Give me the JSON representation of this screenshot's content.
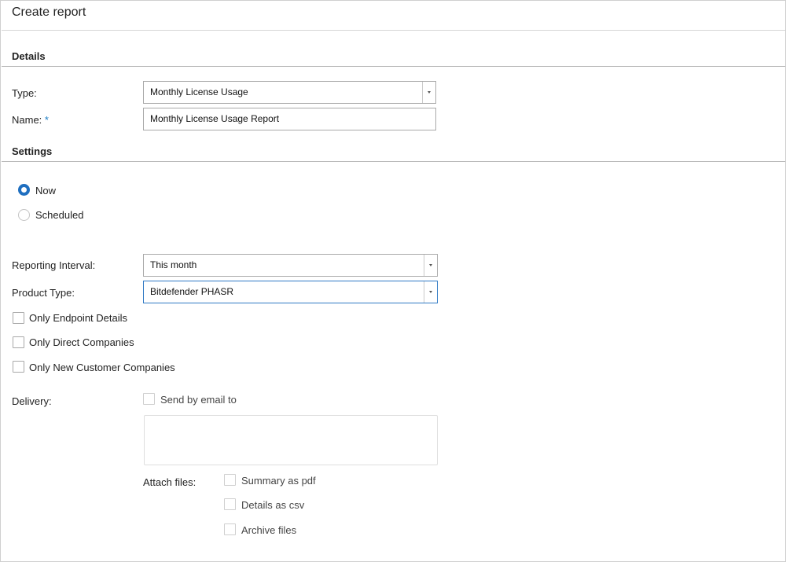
{
  "window": {
    "title": "Create report"
  },
  "details": {
    "heading": "Details",
    "type_label": "Type:",
    "type_value": "Monthly License Usage",
    "name_label": "Name:",
    "name_required_marker": "*",
    "name_value": "Monthly License Usage Report"
  },
  "settings": {
    "heading": "Settings",
    "radio_now": "Now",
    "radio_scheduled": "Scheduled",
    "selected": "Now",
    "interval_label": "Reporting Interval:",
    "interval_value": "This month",
    "product_label": "Product Type:",
    "product_value": "Bitdefender PHASR",
    "check_endpoint": "Only Endpoint Details",
    "check_direct": "Only Direct Companies",
    "check_new_customer": "Only New Customer Companies"
  },
  "delivery": {
    "label": "Delivery:",
    "send_email": "Send by email to",
    "email_value": "",
    "attach_label": "Attach files:",
    "attach_pdf": "Summary as pdf",
    "attach_csv": "Details as csv",
    "attach_archive": "Archive files"
  },
  "colors": {
    "accent": "#1f6fc0",
    "required": "#1a7cc4"
  }
}
